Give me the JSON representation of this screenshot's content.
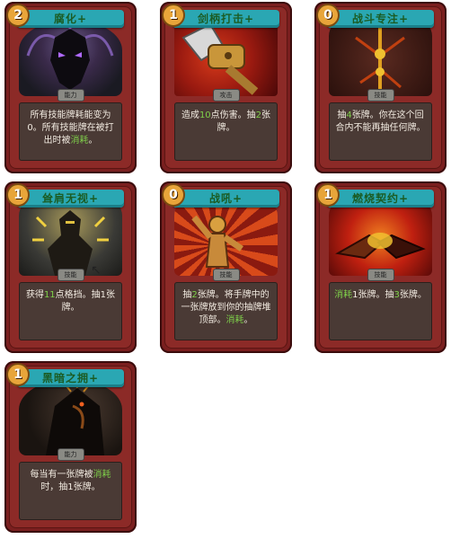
{
  "cards": [
    {
      "id": "c1",
      "cost": "2",
      "title": "腐化+",
      "type": "能力",
      "kind": "power",
      "desc": [
        [
          "所有技能牌耗能变为0。所有技能牌在被打出时被",
          ""
        ],
        [
          "消耗",
          "hl"
        ],
        [
          "。",
          ""
        ]
      ]
    },
    {
      "id": "c2",
      "cost": "1",
      "title": "剑柄打击+",
      "type": "攻击",
      "kind": "attack",
      "desc": [
        [
          "造成",
          ""
        ],
        [
          "10",
          "hl"
        ],
        [
          "点伤害。抽",
          ""
        ],
        [
          "2",
          "hl"
        ],
        [
          "张牌。",
          ""
        ]
      ]
    },
    {
      "id": "c3",
      "cost": "0",
      "title": "战斗专注+",
      "type": "技能",
      "kind": "skill",
      "desc": [
        [
          "抽",
          ""
        ],
        [
          "4",
          "hl"
        ],
        [
          "张牌。你在这个回合内不能再抽任何牌。",
          ""
        ]
      ]
    },
    {
      "id": "c4",
      "cost": "1",
      "title": "耸肩无视+",
      "type": "技能",
      "kind": "skill",
      "desc": [
        [
          "获得",
          ""
        ],
        [
          "11",
          "hl"
        ],
        [
          "点格挡。抽1张牌。",
          ""
        ]
      ]
    },
    {
      "id": "c5",
      "cost": "0",
      "title": "战吼+",
      "type": "技能",
      "kind": "skill",
      "desc": [
        [
          "抽",
          ""
        ],
        [
          "2",
          "hl"
        ],
        [
          "张牌。将手牌中的一张牌放到你的抽牌堆顶部。",
          ""
        ],
        [
          "消耗",
          "hl"
        ],
        [
          "。",
          ""
        ]
      ]
    },
    {
      "id": "c6",
      "cost": "1",
      "title": "燃烧契约+",
      "type": "技能",
      "kind": "skill",
      "desc": [
        [
          "消耗",
          "hl"
        ],
        [
          "1张牌。抽",
          ""
        ],
        [
          "3",
          "hl"
        ],
        [
          "张牌。",
          ""
        ]
      ]
    },
    {
      "id": "c7",
      "cost": "1",
      "title": "黑暗之拥+",
      "type": "能力",
      "kind": "power",
      "desc": [
        [
          "每当有一张牌被",
          ""
        ],
        [
          "消耗",
          "hl"
        ],
        [
          "时，抽1张牌。",
          ""
        ]
      ]
    }
  ],
  "colors": {
    "card": "#7a1f1f",
    "banner": "#2aa7b3",
    "highlight": "#7fd04a",
    "cost": "#e8a53a"
  }
}
